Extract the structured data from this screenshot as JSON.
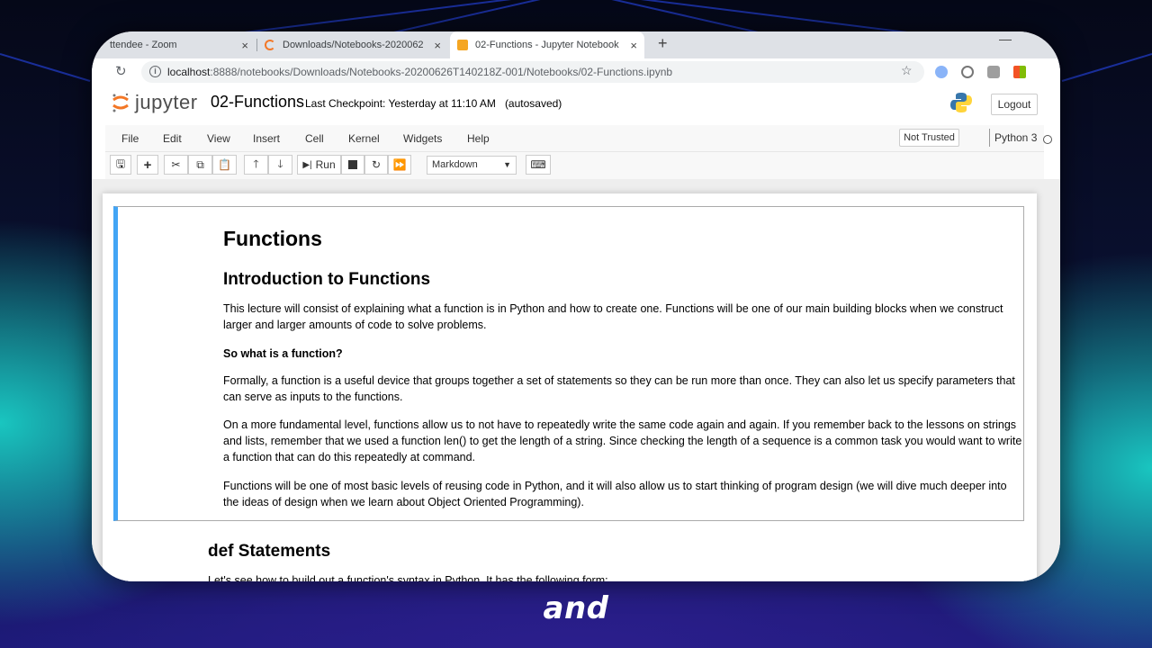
{
  "browser": {
    "tabs": [
      {
        "label": "ttendee - Zoom",
        "close": "×"
      },
      {
        "label": "Downloads/Notebooks-2020062",
        "close": "×"
      },
      {
        "label": "02-Functions - Jupyter Notebook",
        "close": "×"
      }
    ],
    "new_tab": "+",
    "minimize": "—",
    "url_host": "localhost",
    "url_rest": ":8888/notebooks/Downloads/Notebooks-20200626T140218Z-001/Notebooks/02-Functions.ipynb"
  },
  "jupyter": {
    "logo_text": "jupyter",
    "notebook_title": "02-Functions",
    "checkpoint": "Last Checkpoint: Yesterday at 11:10 AM",
    "autosaved": "(autosaved)",
    "logout_label": "Logout",
    "menu": [
      "File",
      "Edit",
      "View",
      "Insert",
      "Cell",
      "Kernel",
      "Widgets",
      "Help"
    ],
    "not_trusted": "Not Trusted",
    "kernel_name": "Python 3",
    "run_label": "Run",
    "cell_type": "Markdown"
  },
  "cell": {
    "h1": "Functions",
    "h2": "Introduction to Functions",
    "p1": "This lecture will consist of explaining what a function is in Python and how to create one. Functions will be one of our main building blocks when we construct larger and larger amounts of code to solve problems.",
    "bold": "So what is a function?",
    "p2": "Formally, a function is a useful device that groups together a set of statements so they can be run more than once. They can also let us specify parameters that can serve as inputs to the functions.",
    "p3": "On a more fundamental level, functions allow us to not have to repeatedly write the same code again and again. If you remember back to the lessons on strings and lists, remember that we used a function len() to get the length of a string. Since checking the length of a sequence is a common task you would want to write a function that can do this repeatedly at command.",
    "p4": "Functions will be one of most basic levels of reusing code in Python, and it will also allow us to start thinking of program design (we will dive much deeper into the ideas of design when we learn about Object Oriented Programming)."
  },
  "next_cell": {
    "h2": "def Statements",
    "partial_line": "Let's see how to build out a function's syntax in Python. It has the following form:"
  },
  "caption": "and",
  "colors": {
    "selected_cell_border": "#42a5f5",
    "jupyter_orange": "#f37726",
    "background_teal": "#19c6c0"
  }
}
